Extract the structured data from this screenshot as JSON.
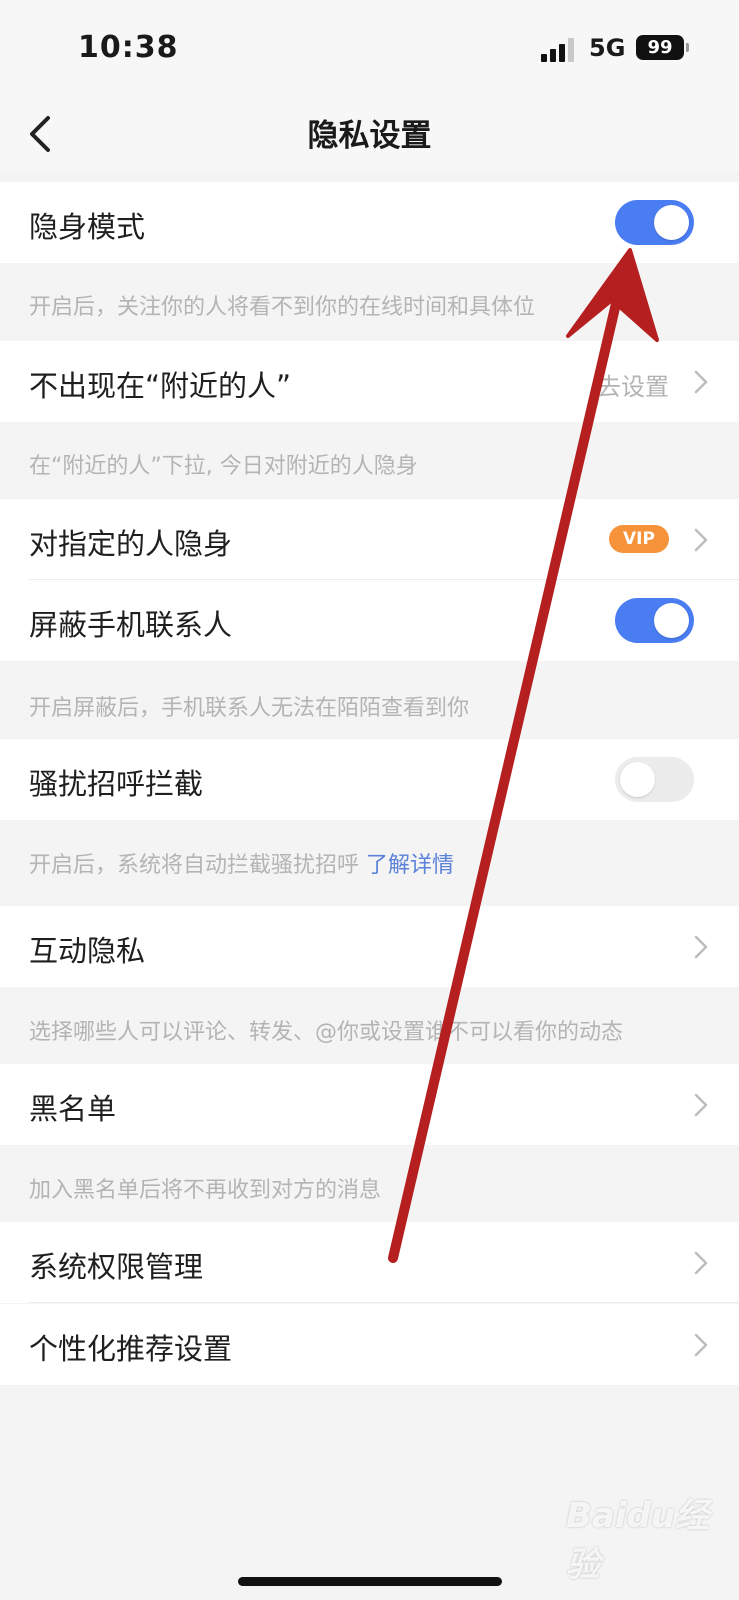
{
  "status_bar": {
    "time": "10:38",
    "network": "5G",
    "battery": "99"
  },
  "nav": {
    "title": "隐私设置",
    "back_icon": "chevron-left-icon"
  },
  "colors": {
    "toggle_on": "#4a7cf2",
    "toggle_off": "#ececec",
    "vip": "#f6923a",
    "link": "#5a82d8",
    "annotation_arrow": "#b51f1f"
  },
  "rows": {
    "invisible_mode": {
      "label": "隐身模式",
      "toggle": "on"
    },
    "invisible_mode_hint": "开启后，关注你的人将看不到你的在线时间和具体位",
    "nearby": {
      "label": "不出现在“附近的人”",
      "value": "去设置"
    },
    "nearby_hint": "在“附近的人”下拉, 今日对附近的人隐身",
    "hide_from_specific": {
      "label": "对指定的人隐身",
      "badge": "VIP"
    },
    "block_contacts": {
      "label": "屏蔽手机联系人",
      "toggle": "on"
    },
    "block_contacts_hint": "开启屏蔽后，手机联系人无法在陌陌查看到你",
    "harass_block": {
      "label": "骚扰招呼拦截",
      "toggle": "off"
    },
    "harass_block_hint": "开启后，系统将自动拦截骚扰招呼",
    "harass_block_link": "了解详情",
    "interaction_privacy": {
      "label": "互动隐私"
    },
    "interaction_privacy_hint": "选择哪些人可以评论、转发、@你或设置谁不可以看你的动态",
    "blacklist": {
      "label": "黑名单"
    },
    "blacklist_hint": "加入黑名单后将不再收到对方的消息",
    "system_permissions": {
      "label": "系统权限管理"
    },
    "personalized_recommendation": {
      "label": "个性化推荐设置"
    }
  },
  "watermark": "Baidu经验"
}
